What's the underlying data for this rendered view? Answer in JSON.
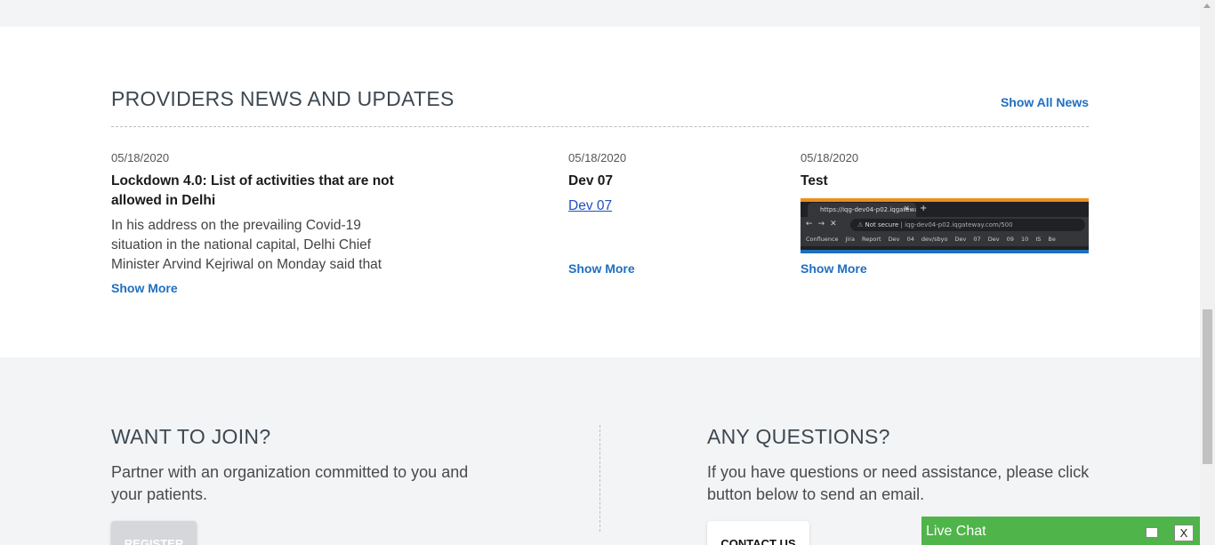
{
  "news": {
    "title": "PROVIDERS NEWS AND UPDATES",
    "show_all": "Show All News",
    "show_more": "Show More",
    "items": [
      {
        "date": "05/18/2020",
        "headline": "Lockdown 4.0: List of activities that are not allowed in Delhi",
        "excerpt": "In his address on the prevailing Covid-19 situation in the national capital, Delhi Chief Minister Arvind Kejriwal on Monday said that"
      },
      {
        "date": "05/18/2020",
        "headline": "Dev 07",
        "link": "Dev 07"
      },
      {
        "date": "05/18/2020",
        "headline": "Test",
        "screenshot": {
          "tab": "https://iqg-dev04-p02.iqgatewa",
          "secure_label": "Not secure",
          "url": "iqg-dev04-p02.iqgateway.com/500",
          "bookmarks": "Confluence  Jira  Report  Dev 04  dev/sbyo  Dev 07  Dev 09  10 IS Be"
        }
      }
    ]
  },
  "join": {
    "title": "WANT TO JOIN?",
    "text": "Partner with an organization committed to you and your patients.",
    "button": "REGISTER"
  },
  "questions": {
    "title": "ANY QUESTIONS?",
    "text": "If you have questions or need assistance, please click button below to send an email.",
    "button": "CONTACT US"
  },
  "chat": {
    "title": "Live Chat",
    "close": "X"
  },
  "colors": {
    "accent_link": "#1f6fc0",
    "chat_green": "#4fb44a"
  }
}
